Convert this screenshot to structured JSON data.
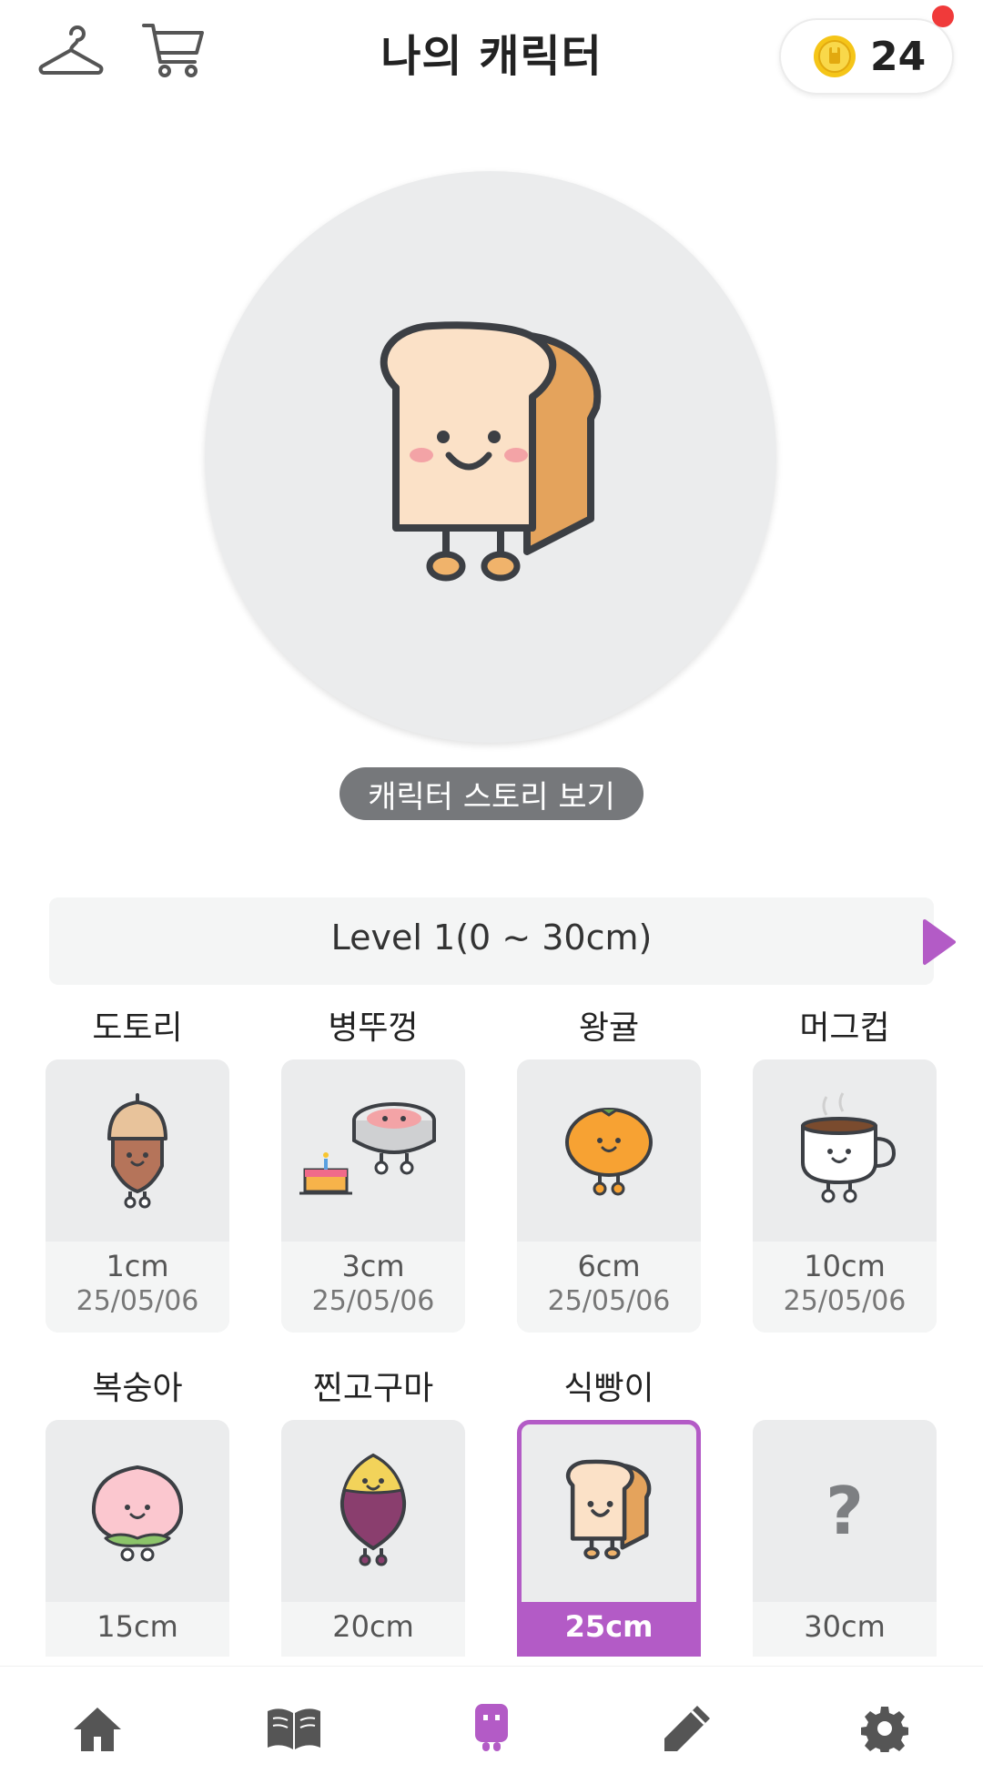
{
  "header": {
    "title": "나의 캐릭터",
    "coin_count": "24",
    "icons": [
      "hanger-icon",
      "cart-icon",
      "coin-icon"
    ]
  },
  "hero": {
    "character": "bread-character",
    "story_button": "캐릭터 스토리 보기"
  },
  "level": {
    "label": "Level 1(0 ~ 30cm)"
  },
  "characters": [
    {
      "name": "도토리",
      "size": "1cm",
      "date": "25/05/06",
      "icon": "acorn-icon"
    },
    {
      "name": "병뚜껑",
      "size": "3cm",
      "date": "25/05/06",
      "icon": "bottle-cap-icon"
    },
    {
      "name": "왕귤",
      "size": "6cm",
      "date": "25/05/06",
      "icon": "tangerine-icon"
    },
    {
      "name": "머그컵",
      "size": "10cm",
      "date": "25/05/06",
      "icon": "mug-icon"
    },
    {
      "name": "복숭아",
      "size": "15cm",
      "icon": "peach-icon"
    },
    {
      "name": "찐고구마",
      "size": "20cm",
      "icon": "sweet-potato-icon"
    },
    {
      "name": "식빵이",
      "size": "25cm",
      "icon": "bread-icon",
      "selected": true
    },
    {
      "name": "",
      "size": "30cm",
      "icon": "question-mark-icon",
      "locked": true,
      "placeholder": "?"
    }
  ],
  "bottom_nav": [
    "home-icon",
    "book-icon",
    "character-icon",
    "pencil-icon",
    "gear-icon"
  ],
  "colors": {
    "accent": "#b35bc6",
    "coin": "#f5c518",
    "notification": "#f03a3a"
  }
}
